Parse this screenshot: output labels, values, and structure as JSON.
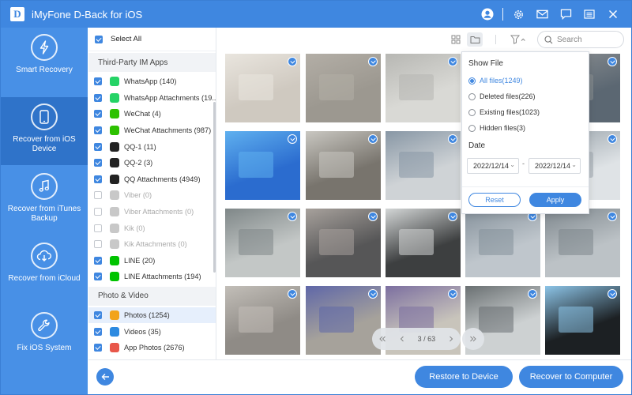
{
  "app": {
    "title": "iMyFone D-Back for iOS",
    "logo_letter": "D"
  },
  "titlebar": {
    "icons": [
      "account-icon",
      "gear-icon",
      "mail-icon",
      "feedback-icon",
      "menu-icon",
      "close-icon"
    ]
  },
  "leftnav": {
    "items": [
      {
        "label": "Smart Recovery",
        "icon": "lightning-icon",
        "active": false
      },
      {
        "label": "Recover from iOS Device",
        "icon": "phone-icon",
        "active": true
      },
      {
        "label": "Recover from iTunes Backup",
        "icon": "music-note-icon",
        "active": false
      },
      {
        "label": "Recover from iCloud",
        "icon": "cloud-download-icon",
        "active": false
      },
      {
        "label": "Fix iOS System",
        "icon": "wrench-icon",
        "active": false
      }
    ]
  },
  "categories": {
    "select_all": "Select All",
    "sections": [
      {
        "title": "Third-Party IM Apps",
        "items": [
          {
            "label": "WhatsApp (140)",
            "checked": true,
            "enabled": true,
            "color": "#25d366",
            "icon": "whatsapp-icon"
          },
          {
            "label": "WhatsApp Attachments (19...",
            "checked": true,
            "enabled": true,
            "color": "#25d366",
            "icon": "whatsapp-icon"
          },
          {
            "label": "WeChat (4)",
            "checked": true,
            "enabled": true,
            "color": "#2dc100",
            "icon": "wechat-icon"
          },
          {
            "label": "WeChat Attachments (987)",
            "checked": true,
            "enabled": true,
            "color": "#2dc100",
            "icon": "wechat-icon"
          },
          {
            "label": "QQ-1 (11)",
            "checked": true,
            "enabled": true,
            "color": "#222222",
            "icon": "qq-icon"
          },
          {
            "label": "QQ-2 (3)",
            "checked": true,
            "enabled": true,
            "color": "#222222",
            "icon": "qq-icon"
          },
          {
            "label": "QQ Attachments (4949)",
            "checked": true,
            "enabled": true,
            "color": "#222222",
            "icon": "qq-icon"
          },
          {
            "label": "Viber (0)",
            "checked": false,
            "enabled": false,
            "color": "#9b9b9b",
            "icon": "viber-icon"
          },
          {
            "label": "Viber Attachments (0)",
            "checked": false,
            "enabled": false,
            "color": "#9b9b9b",
            "icon": "viber-icon"
          },
          {
            "label": "Kik (0)",
            "checked": false,
            "enabled": false,
            "color": "#b5b5b5",
            "icon": "kik-icon"
          },
          {
            "label": "Kik Attachments (0)",
            "checked": false,
            "enabled": false,
            "color": "#b5b5b5",
            "icon": "kik-icon"
          },
          {
            "label": "LINE (20)",
            "checked": true,
            "enabled": true,
            "color": "#00c300",
            "icon": "line-icon"
          },
          {
            "label": "LINE Attachments (194)",
            "checked": true,
            "enabled": true,
            "color": "#00c300",
            "icon": "line-icon"
          }
        ]
      },
      {
        "title": "Photo & Video",
        "items": [
          {
            "label": "Photos (1254)",
            "checked": true,
            "enabled": true,
            "selected": true,
            "color": "#f2a31b",
            "icon": "photos-icon"
          },
          {
            "label": "Videos (35)",
            "checked": true,
            "enabled": true,
            "color": "#2d8ae0",
            "icon": "video-icon"
          },
          {
            "label": "App Photos (2676)",
            "checked": true,
            "enabled": true,
            "color": "#e8574a",
            "icon": "app-photos-icon"
          }
        ]
      }
    ]
  },
  "toolbar": {
    "view_icons": [
      "grid-view-icon",
      "folder-view-icon"
    ],
    "filter_icon": "filter-icon",
    "search_placeholder": "Search"
  },
  "filter_popup": {
    "title": "Show File",
    "options": [
      {
        "label": "All files(1249)",
        "selected": true
      },
      {
        "label": "Deleted files(226)",
        "selected": false
      },
      {
        "label": "Existing files(1023)",
        "selected": false
      },
      {
        "label": "Hidden files(3)",
        "selected": false
      }
    ],
    "date_label": "Date",
    "date_from": "2022/12/14",
    "date_to": "2022/12/14",
    "date_separator": "-",
    "reset_label": "Reset",
    "apply_label": "Apply"
  },
  "thumbnails": [
    {
      "bg": "#cfc9c0",
      "accent": "#e9e5de",
      "checked": true
    },
    {
      "bg": "#9c9890",
      "accent": "#b3aea6",
      "checked": true
    },
    {
      "bg": "#d9d9d5",
      "accent": "#b7b7b3",
      "checked": true
    },
    {
      "bg": "#d8d8d8",
      "accent": "#c4c4c4",
      "checked": true
    },
    {
      "bg": "#5b6772",
      "accent": "#8b8f92",
      "checked": true
    },
    {
      "bg": "#2b6ccf",
      "accent": "#5fb0ef",
      "checked": true
    },
    {
      "bg": "#78746d",
      "accent": "#c9c7c1",
      "checked": true
    },
    {
      "bg": "#cfd3d6",
      "accent": "#8897a5",
      "checked": true
    },
    {
      "bg": "#d7d8d4",
      "accent": "#babbb6",
      "checked": true
    },
    {
      "bg": "#dfe3e6",
      "accent": "#9aa4ab",
      "checked": true
    },
    {
      "bg": "#c3c7c6",
      "accent": "#7f8788",
      "checked": true
    },
    {
      "bg": "#565657",
      "accent": "#a7a19c",
      "checked": true
    },
    {
      "bg": "#3d3f40",
      "accent": "#d3d6d6",
      "checked": true
    },
    {
      "bg": "#bfc6cc",
      "accent": "#85919b",
      "checked": true
    },
    {
      "bg": "#bcc2c6",
      "accent": "#7e878d",
      "checked": true
    },
    {
      "bg": "#8f8b86",
      "accent": "#c2beb8",
      "checked": true
    },
    {
      "bg": "#a6a29b",
      "accent": "#5f67a8",
      "checked": true
    },
    {
      "bg": "#c8c4bb",
      "accent": "#7c6fa0",
      "checked": true
    },
    {
      "bg": "#cdd1d2",
      "accent": "#6a7072",
      "checked": true
    },
    {
      "bg": "#1c2023",
      "accent": "#8cc4e7",
      "checked": true
    }
  ],
  "pager": {
    "text": "3 / 63"
  },
  "bottom": {
    "back_icon": "arrow-left-icon",
    "restore_label": "Restore to Device",
    "recover_label": "Recover to Computer"
  },
  "colors": {
    "primary": "#3f87e0",
    "nav_bg": "#4890e6",
    "nav_active": "#2f73c9"
  }
}
